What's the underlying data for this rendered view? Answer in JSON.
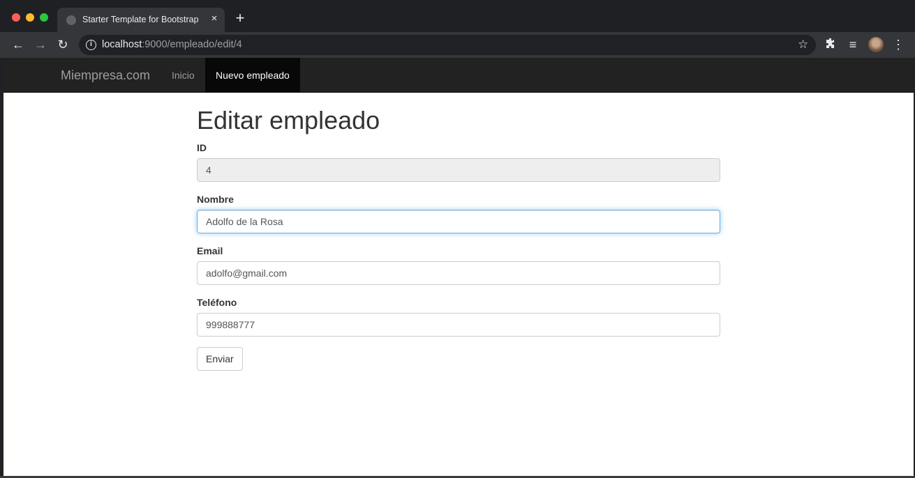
{
  "browser": {
    "tab_title": "Starter Template for Bootstrap",
    "tab_close_icon": "×",
    "new_tab_icon": "+",
    "url_host": "localhost",
    "url_rest": ":9000/empleado/edit/4",
    "back_icon": "←",
    "forward_icon": "→",
    "reload_icon": "↻",
    "info_icon": "i",
    "star_icon": "☆",
    "extensions_icon": "puzzle",
    "media_icon": "≡",
    "menu_icon": "⋮"
  },
  "navbar": {
    "brand": "Miempresa.com",
    "links": [
      {
        "label": "Inicio",
        "active": false
      },
      {
        "label": "Nuevo empleado",
        "active": true
      }
    ]
  },
  "page": {
    "title": "Editar empleado",
    "fields": {
      "id": {
        "label": "ID",
        "value": "4"
      },
      "nombre": {
        "label": "Nombre",
        "value": "Adolfo de la Rosa"
      },
      "email": {
        "label": "Email",
        "value": "adolfo@gmail.com"
      },
      "telefono": {
        "label": "Teléfono",
        "value": "999888777"
      }
    },
    "submit_label": "Enviar"
  },
  "colors": {
    "navbar_bg": "#222222",
    "nav_active_bg": "#080808",
    "focus_border": "#66afe9"
  }
}
